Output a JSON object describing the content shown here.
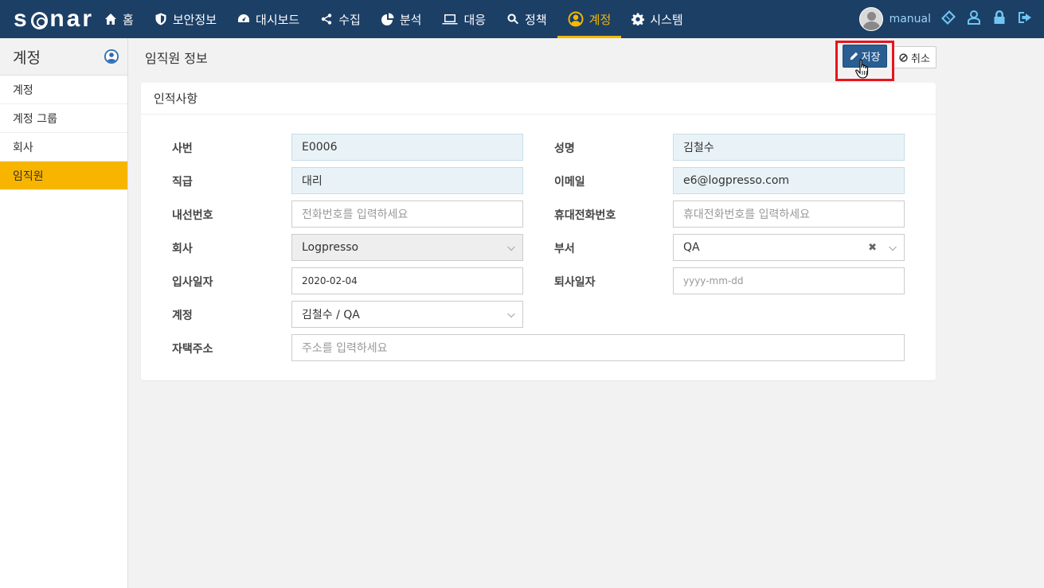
{
  "app": {
    "logo": "sonar"
  },
  "nav": {
    "items": [
      {
        "label": "홈",
        "icon": "home-icon"
      },
      {
        "label": "보안정보",
        "icon": "shield-icon"
      },
      {
        "label": "대시보드",
        "icon": "dashboard-icon"
      },
      {
        "label": "수집",
        "icon": "share-icon"
      },
      {
        "label": "분석",
        "icon": "pie-chart-icon"
      },
      {
        "label": "대응",
        "icon": "laptop-icon"
      },
      {
        "label": "정책",
        "icon": "search-icon"
      },
      {
        "label": "계정",
        "icon": "user-circle-icon",
        "active": true
      },
      {
        "label": "시스템",
        "icon": "gear-icon"
      }
    ],
    "active_color": "#f5b800",
    "bar_color": "#1c3f66"
  },
  "user": {
    "name": "manual"
  },
  "sidebar": {
    "title": "계정",
    "items": [
      {
        "label": "계정"
      },
      {
        "label": "계정 그룹"
      },
      {
        "label": "회사"
      },
      {
        "label": "임직원",
        "active": true
      }
    ]
  },
  "page": {
    "title": "임직원 정보",
    "save_label": "저장",
    "cancel_label": "취소"
  },
  "panel": {
    "title": "인적사항"
  },
  "form": {
    "emp_no": {
      "label": "사번",
      "value": "E0006"
    },
    "name": {
      "label": "성명",
      "value": "김철수"
    },
    "position": {
      "label": "직급",
      "value": "대리"
    },
    "email": {
      "label": "이메일",
      "value": "e6@logpresso.com"
    },
    "ext": {
      "label": "내선번호",
      "placeholder": "전화번호를 입력하세요"
    },
    "mobile": {
      "label": "휴대전화번호",
      "placeholder": "휴대전화번호를 입력하세요"
    },
    "company": {
      "label": "회사",
      "value": "Logpresso"
    },
    "dept": {
      "label": "부서",
      "value": "QA"
    },
    "join_date": {
      "label": "입사일자",
      "value": "2020-02-04"
    },
    "leave_date": {
      "label": "퇴사일자",
      "placeholder": "yyyy-mm-dd"
    },
    "account": {
      "label": "계정",
      "value": "김철수 / QA"
    },
    "address": {
      "label": "자택주소",
      "placeholder": "주소를 입력하세요"
    }
  }
}
